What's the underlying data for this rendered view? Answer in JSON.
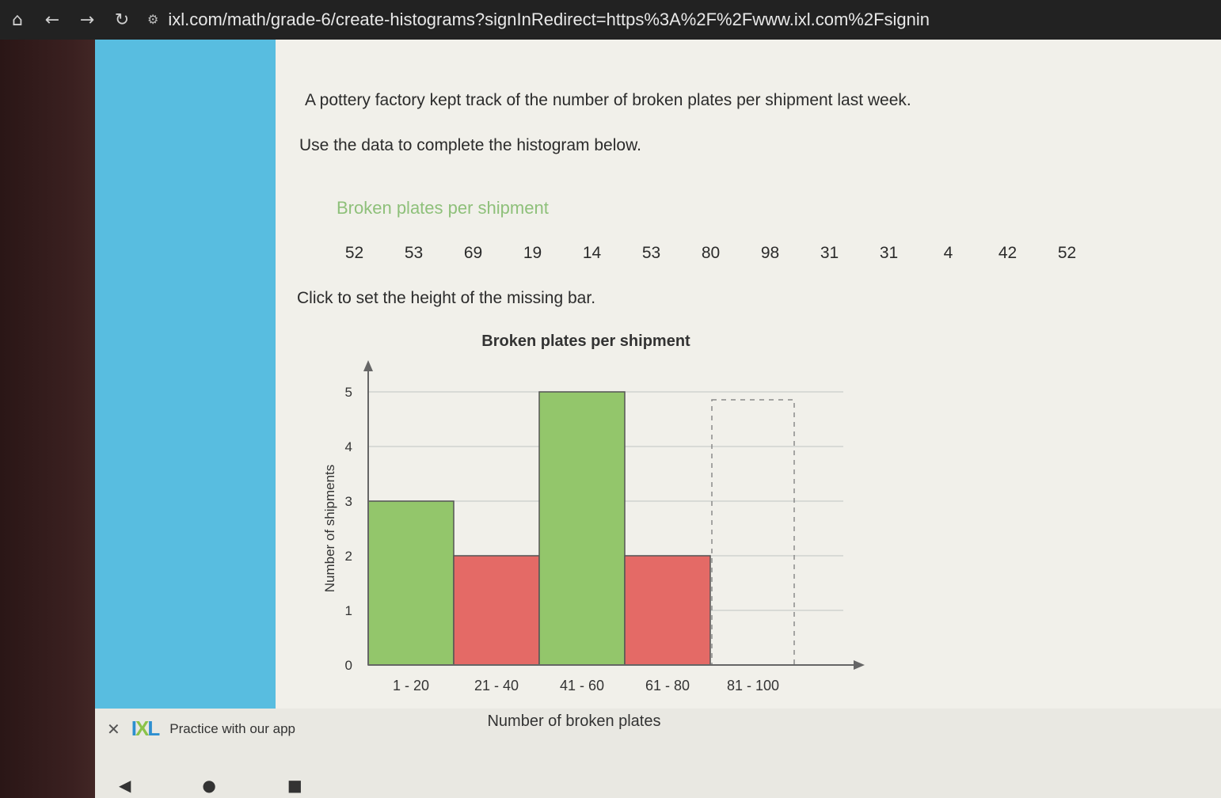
{
  "browser": {
    "url": "ixl.com/math/grade-6/create-histograms?signInRedirect=https%3A%2F%2Fwww.ixl.com%2Fsignin"
  },
  "question": {
    "line1": "A pottery factory kept track of the number of broken plates per shipment last week.",
    "line2": "Use the data to complete the histogram below.",
    "data_title": "Broken plates per shipment",
    "data_values": [
      "52",
      "53",
      "69",
      "19",
      "14",
      "53",
      "80",
      "98",
      "31",
      "31",
      "4",
      "42",
      "52"
    ],
    "instruction": "Click to set the height of the missing bar."
  },
  "chart_data": {
    "type": "bar",
    "title": "Broken plates per shipment",
    "xlabel": "Number of broken plates",
    "ylabel": "Number of shipments",
    "categories": [
      "1 - 20",
      "21 - 40",
      "41 - 60",
      "61 - 80",
      "81 - 100"
    ],
    "values": [
      3,
      2,
      5,
      2,
      null
    ],
    "ylim": [
      0,
      5
    ],
    "yticks": [
      "0",
      "1",
      "2",
      "3",
      "4",
      "5"
    ],
    "bar_colors": [
      "#93c66b",
      "#e46a66",
      "#93c66b",
      "#e46a66",
      null
    ],
    "missing_bar_index": 4,
    "grid": true
  },
  "colors": {
    "sidebar": "#58bde0",
    "green_bar": "#93c66b",
    "red_bar": "#e46a66",
    "data_title": "#8ec07a"
  },
  "app_banner": {
    "close_icon": "close-icon",
    "logo_text_1": "I",
    "logo_text_2": "X",
    "logo_text_3": "L",
    "text": "Practice with our app"
  }
}
